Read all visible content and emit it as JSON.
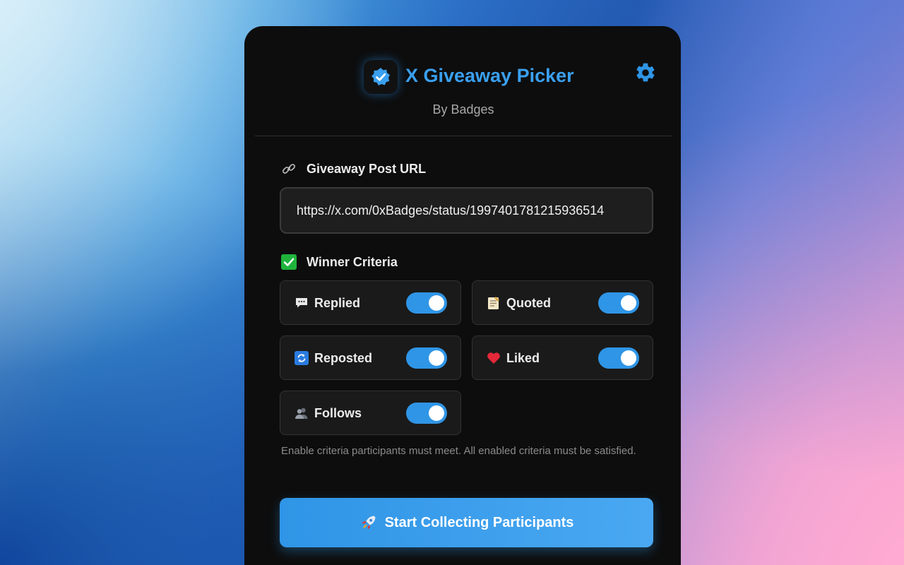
{
  "header": {
    "title": "X Giveaway Picker",
    "subtitle": "By Badges",
    "logo_icon": "verified-badge-icon",
    "settings_icon": "gear-icon"
  },
  "url_section": {
    "label": "Giveaway Post URL",
    "icon": "link-icon",
    "value": "https://x.com/0xBadges/status/1997401781215936514"
  },
  "criteria": {
    "label": "Winner Criteria",
    "icon": "checkbox-icon",
    "items": [
      {
        "label": "Replied",
        "icon": "speech-bubble-icon",
        "enabled": true
      },
      {
        "label": "Quoted",
        "icon": "memo-icon",
        "enabled": true
      },
      {
        "label": "Reposted",
        "icon": "repeat-icon",
        "enabled": true
      },
      {
        "label": "Liked",
        "icon": "heart-icon",
        "enabled": true
      },
      {
        "label": "Follows",
        "icon": "people-icon",
        "enabled": true
      }
    ],
    "help_text": "Enable criteria participants must meet. All enabled criteria must be satisfied."
  },
  "actions": {
    "start_label": "Start Collecting Participants",
    "start_icon": "rocket-icon"
  },
  "colors": {
    "accent": "#2f95e6",
    "title": "#3aa0f0",
    "panel_bg": "#0d0d0d",
    "card_bg": "#1a1a1a"
  }
}
